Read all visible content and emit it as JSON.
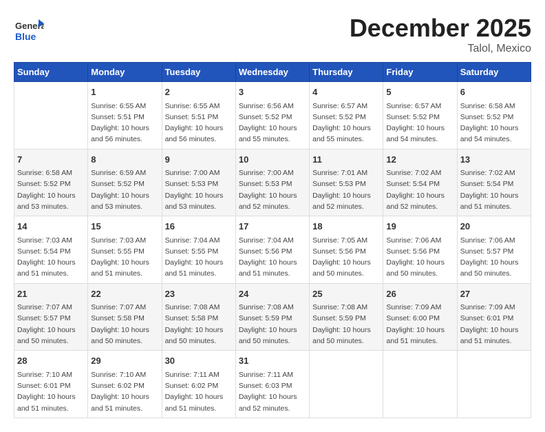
{
  "header": {
    "logo_general": "General",
    "logo_blue": "Blue",
    "title": "December 2025",
    "subtitle": "Talol, Mexico"
  },
  "columns": [
    "Sunday",
    "Monday",
    "Tuesday",
    "Wednesday",
    "Thursday",
    "Friday",
    "Saturday"
  ],
  "weeks": [
    [
      {
        "day": "",
        "info": ""
      },
      {
        "day": "1",
        "info": "Sunrise: 6:55 AM\nSunset: 5:51 PM\nDaylight: 10 hours\nand 56 minutes."
      },
      {
        "day": "2",
        "info": "Sunrise: 6:55 AM\nSunset: 5:51 PM\nDaylight: 10 hours\nand 56 minutes."
      },
      {
        "day": "3",
        "info": "Sunrise: 6:56 AM\nSunset: 5:52 PM\nDaylight: 10 hours\nand 55 minutes."
      },
      {
        "day": "4",
        "info": "Sunrise: 6:57 AM\nSunset: 5:52 PM\nDaylight: 10 hours\nand 55 minutes."
      },
      {
        "day": "5",
        "info": "Sunrise: 6:57 AM\nSunset: 5:52 PM\nDaylight: 10 hours\nand 54 minutes."
      },
      {
        "day": "6",
        "info": "Sunrise: 6:58 AM\nSunset: 5:52 PM\nDaylight: 10 hours\nand 54 minutes."
      }
    ],
    [
      {
        "day": "7",
        "info": "Sunrise: 6:58 AM\nSunset: 5:52 PM\nDaylight: 10 hours\nand 53 minutes."
      },
      {
        "day": "8",
        "info": "Sunrise: 6:59 AM\nSunset: 5:52 PM\nDaylight: 10 hours\nand 53 minutes."
      },
      {
        "day": "9",
        "info": "Sunrise: 7:00 AM\nSunset: 5:53 PM\nDaylight: 10 hours\nand 53 minutes."
      },
      {
        "day": "10",
        "info": "Sunrise: 7:00 AM\nSunset: 5:53 PM\nDaylight: 10 hours\nand 52 minutes."
      },
      {
        "day": "11",
        "info": "Sunrise: 7:01 AM\nSunset: 5:53 PM\nDaylight: 10 hours\nand 52 minutes."
      },
      {
        "day": "12",
        "info": "Sunrise: 7:02 AM\nSunset: 5:54 PM\nDaylight: 10 hours\nand 52 minutes."
      },
      {
        "day": "13",
        "info": "Sunrise: 7:02 AM\nSunset: 5:54 PM\nDaylight: 10 hours\nand 51 minutes."
      }
    ],
    [
      {
        "day": "14",
        "info": "Sunrise: 7:03 AM\nSunset: 5:54 PM\nDaylight: 10 hours\nand 51 minutes."
      },
      {
        "day": "15",
        "info": "Sunrise: 7:03 AM\nSunset: 5:55 PM\nDaylight: 10 hours\nand 51 minutes."
      },
      {
        "day": "16",
        "info": "Sunrise: 7:04 AM\nSunset: 5:55 PM\nDaylight: 10 hours\nand 51 minutes."
      },
      {
        "day": "17",
        "info": "Sunrise: 7:04 AM\nSunset: 5:56 PM\nDaylight: 10 hours\nand 51 minutes."
      },
      {
        "day": "18",
        "info": "Sunrise: 7:05 AM\nSunset: 5:56 PM\nDaylight: 10 hours\nand 50 minutes."
      },
      {
        "day": "19",
        "info": "Sunrise: 7:06 AM\nSunset: 5:56 PM\nDaylight: 10 hours\nand 50 minutes."
      },
      {
        "day": "20",
        "info": "Sunrise: 7:06 AM\nSunset: 5:57 PM\nDaylight: 10 hours\nand 50 minutes."
      }
    ],
    [
      {
        "day": "21",
        "info": "Sunrise: 7:07 AM\nSunset: 5:57 PM\nDaylight: 10 hours\nand 50 minutes."
      },
      {
        "day": "22",
        "info": "Sunrise: 7:07 AM\nSunset: 5:58 PM\nDaylight: 10 hours\nand 50 minutes."
      },
      {
        "day": "23",
        "info": "Sunrise: 7:08 AM\nSunset: 5:58 PM\nDaylight: 10 hours\nand 50 minutes."
      },
      {
        "day": "24",
        "info": "Sunrise: 7:08 AM\nSunset: 5:59 PM\nDaylight: 10 hours\nand 50 minutes."
      },
      {
        "day": "25",
        "info": "Sunrise: 7:08 AM\nSunset: 5:59 PM\nDaylight: 10 hours\nand 50 minutes."
      },
      {
        "day": "26",
        "info": "Sunrise: 7:09 AM\nSunset: 6:00 PM\nDaylight: 10 hours\nand 51 minutes."
      },
      {
        "day": "27",
        "info": "Sunrise: 7:09 AM\nSunset: 6:01 PM\nDaylight: 10 hours\nand 51 minutes."
      }
    ],
    [
      {
        "day": "28",
        "info": "Sunrise: 7:10 AM\nSunset: 6:01 PM\nDaylight: 10 hours\nand 51 minutes."
      },
      {
        "day": "29",
        "info": "Sunrise: 7:10 AM\nSunset: 6:02 PM\nDaylight: 10 hours\nand 51 minutes."
      },
      {
        "day": "30",
        "info": "Sunrise: 7:11 AM\nSunset: 6:02 PM\nDaylight: 10 hours\nand 51 minutes."
      },
      {
        "day": "31",
        "info": "Sunrise: 7:11 AM\nSunset: 6:03 PM\nDaylight: 10 hours\nand 52 minutes."
      },
      {
        "day": "",
        "info": ""
      },
      {
        "day": "",
        "info": ""
      },
      {
        "day": "",
        "info": ""
      }
    ]
  ]
}
